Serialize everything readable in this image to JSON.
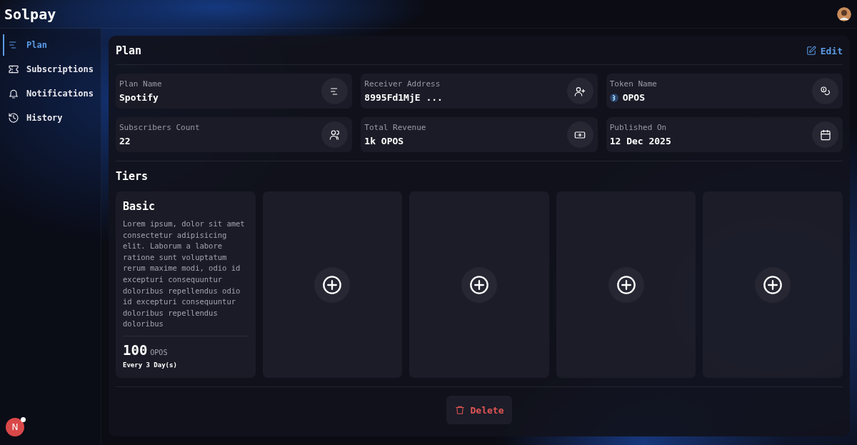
{
  "app": {
    "title": "Solpay"
  },
  "sidebar": {
    "items": [
      {
        "label": "Plan",
        "selected": true
      },
      {
        "label": "Subscriptions",
        "selected": false
      },
      {
        "label": "Notifications",
        "selected": false
      },
      {
        "label": "History",
        "selected": false
      }
    ]
  },
  "dev_badge": {
    "label": "N"
  },
  "plan": {
    "title": "Plan",
    "edit_label": "Edit",
    "fields": [
      {
        "label": "Plan Name",
        "value": "Spotify"
      },
      {
        "label": "Receiver Address",
        "value": "8995Fd1MjE ..."
      },
      {
        "label": "Token Name",
        "value": "OPOS",
        "token": true
      },
      {
        "label": "Subscribers Count",
        "value": "22"
      },
      {
        "label": "Total Revenue",
        "value": "1k OPOS"
      },
      {
        "label": "Published On",
        "value": "12 Dec 2025"
      }
    ],
    "tiers_title": "Tiers",
    "tiers": [
      {
        "kind": "tier",
        "name": "Basic",
        "description": "Lorem ipsum, dolor sit amet consectetur adipisicing elit. Laborum a labore ratione sunt voluptatum rerum maxime modi, odio id excepturi consequuntur doloribus repellendus odio id excepturi consequuntur doloribus repellendus doloribus",
        "price": "100",
        "unit": "OPOS",
        "period": "Every 3 Day(s)"
      },
      {
        "kind": "empty"
      },
      {
        "kind": "empty"
      },
      {
        "kind": "empty"
      },
      {
        "kind": "empty"
      }
    ],
    "delete_label": "Delete"
  }
}
